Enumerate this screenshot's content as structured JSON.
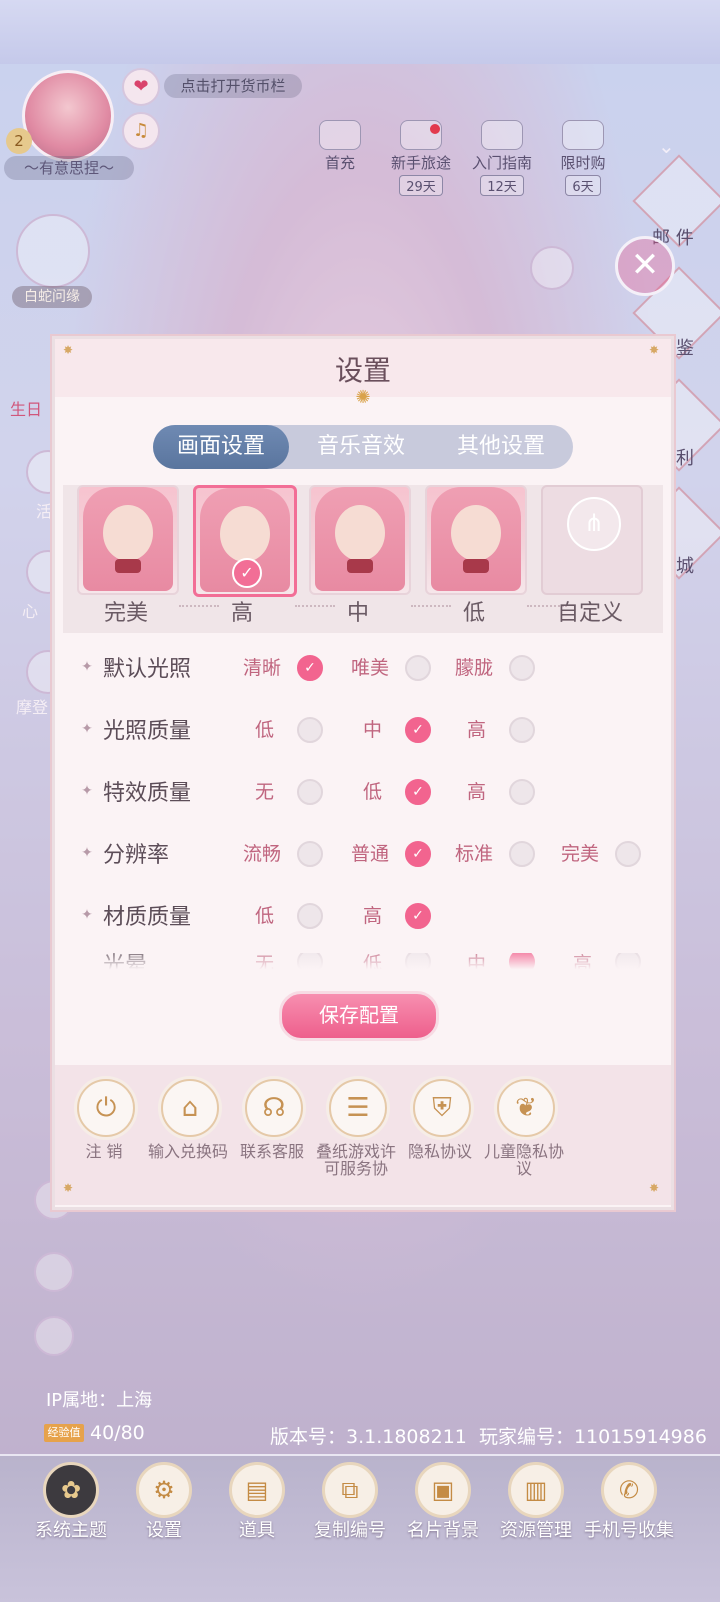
{
  "hud": {
    "level": "2",
    "nickname": "～有意思捏～",
    "currency_hint": "点击打开货币栏",
    "buttons": [
      {
        "label": "首充",
        "days": ""
      },
      {
        "label": "新手旅途",
        "days": "29天"
      },
      {
        "label": "入门指南",
        "days": "12天"
      },
      {
        "label": "限时购",
        "days": "6天"
      }
    ],
    "left_labels": [
      "白蛇问缘",
      "生日",
      "活",
      "心",
      "摩登"
    ],
    "right_labels": [
      "邮 件",
      "鉴",
      "利",
      "城"
    ]
  },
  "dialog": {
    "title": "设置",
    "tabs": [
      "画面设置",
      "音乐音效",
      "其他设置"
    ],
    "active_tab": 0,
    "quality_presets": [
      "完美",
      "高",
      "中",
      "低",
      "自定义"
    ],
    "selected_preset": 1,
    "settings": [
      {
        "name": "默认光照",
        "options": [
          "清晰",
          "唯美",
          "朦胧"
        ],
        "selected": 0
      },
      {
        "name": "光照质量",
        "options": [
          "低",
          "中",
          "高"
        ],
        "selected": 1
      },
      {
        "name": "特效质量",
        "options": [
          "无",
          "低",
          "高"
        ],
        "selected": 1
      },
      {
        "name": "分辨率",
        "options": [
          "流畅",
          "普通",
          "标准",
          "完美"
        ],
        "selected": 1
      },
      {
        "name": "材质质量",
        "options": [
          "低",
          "高"
        ],
        "selected": 1
      },
      {
        "name": "光晕",
        "options": [
          "无",
          "低",
          "中",
          "高"
        ],
        "selected": 2
      }
    ],
    "save_label": "保存配置",
    "bottom_actions": [
      "注 销",
      "输入兑换码",
      "联系客服",
      "叠纸游戏许可服务协",
      "隐私协议",
      "儿童隐私协议"
    ]
  },
  "footer": {
    "ip": "IP属地：上海",
    "exp_badge": "经验值",
    "exp": "40/80",
    "version": "版本号：3.1.1808211",
    "player_id": "玩家编号：11015914986"
  },
  "bottom_bar": [
    "系统主题",
    "设置",
    "道具",
    "复制编号",
    "名片背景",
    "资源管理",
    "手机号收集"
  ]
}
